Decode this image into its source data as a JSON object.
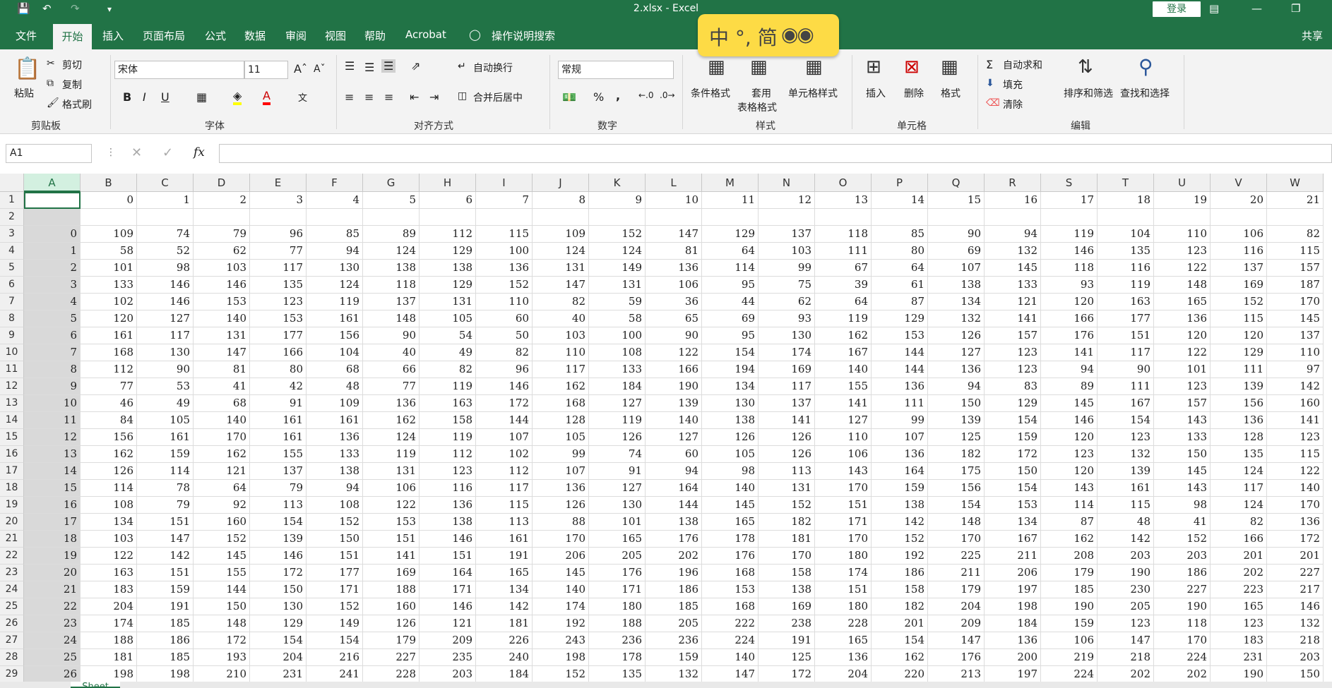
{
  "title": "2.xlsx  -  Excel",
  "login": "登录",
  "menu": [
    "文件",
    "开始",
    "插入",
    "页面布局",
    "公式",
    "数据",
    "审阅",
    "视图",
    "帮助",
    "Acrobat",
    "操作说明搜索"
  ],
  "share": "共享",
  "ime": {
    "text": "中 °, 简"
  },
  "clipboard": {
    "paste": "粘贴",
    "cut": "剪切",
    "copy": "复制",
    "format_painter": "格式刷",
    "group": "剪贴板"
  },
  "font": {
    "name": "宋体",
    "size": "11",
    "bold": "B",
    "italic": "I",
    "underline": "U",
    "group": "字体"
  },
  "align": {
    "wrap": "自动换行",
    "merge": "合并后居中",
    "group": "对齐方式"
  },
  "number": {
    "format": "常规",
    "percent": "%",
    "comma": ",",
    "group": "数字"
  },
  "styles": {
    "cond": "条件格式",
    "table_line1": "套用",
    "table_line2": "表格格式",
    "cell": "单元格样式",
    "group": "样式"
  },
  "cells": {
    "insert": "插入",
    "delete": "删除",
    "format": "格式",
    "group": "单元格"
  },
  "editing": {
    "autosum": "自动求和",
    "fill": "填充",
    "clear": "清除",
    "sort": "排序和筛选",
    "find": "查找和选择",
    "group": "编辑"
  },
  "namebox": "A1",
  "fx": "fx",
  "columns": [
    "A",
    "B",
    "C",
    "D",
    "E",
    "F",
    "G",
    "H",
    "I",
    "J",
    "K",
    "L",
    "M",
    "N",
    "O",
    "P",
    "Q",
    "R",
    "S",
    "T",
    "U",
    "V",
    "W"
  ],
  "header_row": [
    "",
    "0",
    "1",
    "2",
    "3",
    "4",
    "5",
    "6",
    "7",
    "8",
    "9",
    "10",
    "11",
    "12",
    "13",
    "14",
    "15",
    "16",
    "17",
    "18",
    "19",
    "20",
    "21"
  ],
  "data_rows": [
    [
      0,
      109,
      74,
      79,
      96,
      85,
      89,
      112,
      115,
      109,
      152,
      147,
      129,
      137,
      118,
      85,
      90,
      94,
      119,
      104,
      110,
      106,
      82
    ],
    [
      1,
      58,
      52,
      62,
      77,
      94,
      124,
      129,
      100,
      124,
      124,
      81,
      64,
      103,
      111,
      80,
      69,
      132,
      146,
      135,
      123,
      116,
      115
    ],
    [
      2,
      101,
      98,
      103,
      117,
      130,
      138,
      138,
      136,
      131,
      149,
      136,
      114,
      99,
      67,
      64,
      107,
      145,
      118,
      116,
      122,
      137,
      157
    ],
    [
      3,
      133,
      146,
      146,
      135,
      124,
      118,
      129,
      152,
      147,
      131,
      106,
      95,
      75,
      39,
      61,
      138,
      133,
      93,
      119,
      148,
      169,
      187
    ],
    [
      4,
      102,
      146,
      153,
      123,
      119,
      137,
      131,
      110,
      82,
      59,
      36,
      44,
      62,
      64,
      87,
      134,
      121,
      120,
      163,
      165,
      152,
      170
    ],
    [
      5,
      120,
      127,
      140,
      153,
      161,
      148,
      105,
      60,
      40,
      58,
      65,
      69,
      93,
      119,
      129,
      132,
      141,
      166,
      177,
      136,
      115,
      145
    ],
    [
      6,
      161,
      117,
      131,
      177,
      156,
      90,
      54,
      50,
      103,
      100,
      90,
      95,
      130,
      162,
      153,
      126,
      157,
      176,
      151,
      120,
      120,
      137
    ],
    [
      7,
      168,
      130,
      147,
      166,
      104,
      40,
      49,
      82,
      110,
      108,
      122,
      154,
      174,
      167,
      144,
      127,
      123,
      141,
      117,
      122,
      129,
      110
    ],
    [
      8,
      112,
      90,
      81,
      80,
      68,
      66,
      82,
      96,
      117,
      133,
      166,
      194,
      169,
      140,
      144,
      136,
      123,
      94,
      90,
      101,
      111,
      97
    ],
    [
      9,
      77,
      53,
      41,
      42,
      48,
      77,
      119,
      146,
      162,
      184,
      190,
      134,
      117,
      155,
      136,
      94,
      83,
      89,
      111,
      123,
      139,
      142
    ],
    [
      10,
      46,
      49,
      68,
      91,
      109,
      136,
      163,
      172,
      168,
      127,
      139,
      130,
      137,
      141,
      111,
      150,
      129,
      145,
      167,
      157,
      156,
      160
    ],
    [
      11,
      84,
      105,
      140,
      161,
      161,
      162,
      158,
      144,
      128,
      119,
      140,
      138,
      141,
      127,
      99,
      139,
      154,
      146,
      154,
      143,
      136,
      141
    ],
    [
      12,
      156,
      161,
      170,
      161,
      136,
      124,
      119,
      107,
      105,
      126,
      127,
      126,
      126,
      110,
      107,
      125,
      159,
      120,
      123,
      133,
      128,
      123
    ],
    [
      13,
      162,
      159,
      162,
      155,
      133,
      119,
      112,
      102,
      99,
      74,
      60,
      105,
      126,
      106,
      136,
      182,
      172,
      123,
      132,
      150,
      135,
      115
    ],
    [
      14,
      126,
      114,
      121,
      137,
      138,
      131,
      123,
      112,
      107,
      91,
      94,
      98,
      113,
      143,
      164,
      175,
      150,
      120,
      139,
      145,
      124,
      122
    ],
    [
      15,
      114,
      78,
      64,
      79,
      94,
      106,
      116,
      117,
      136,
      127,
      164,
      140,
      131,
      170,
      159,
      156,
      154,
      143,
      161,
      143,
      117,
      140
    ],
    [
      16,
      108,
      79,
      92,
      113,
      108,
      122,
      136,
      115,
      126,
      130,
      144,
      145,
      152,
      151,
      138,
      154,
      153,
      114,
      115,
      98,
      124,
      170
    ],
    [
      17,
      134,
      151,
      160,
      154,
      152,
      153,
      138,
      113,
      88,
      101,
      138,
      165,
      182,
      171,
      142,
      148,
      134,
      87,
      48,
      41,
      82,
      136
    ],
    [
      18,
      103,
      147,
      152,
      139,
      150,
      151,
      146,
      161,
      170,
      165,
      176,
      178,
      181,
      170,
      152,
      170,
      167,
      162,
      142,
      152,
      166,
      172
    ],
    [
      19,
      122,
      142,
      145,
      146,
      151,
      141,
      151,
      191,
      206,
      205,
      202,
      176,
      170,
      180,
      192,
      225,
      211,
      208,
      203,
      203,
      201,
      201
    ],
    [
      20,
      163,
      151,
      155,
      172,
      177,
      169,
      164,
      165,
      145,
      176,
      196,
      168,
      158,
      174,
      186,
      211,
      206,
      179,
      190,
      186,
      202,
      227
    ],
    [
      21,
      183,
      159,
      144,
      150,
      171,
      188,
      171,
      134,
      140,
      171,
      186,
      153,
      138,
      151,
      158,
      179,
      197,
      185,
      230,
      227,
      223,
      217
    ],
    [
      22,
      204,
      191,
      150,
      130,
      152,
      160,
      146,
      142,
      174,
      180,
      185,
      168,
      169,
      180,
      182,
      204,
      198,
      190,
      205,
      190,
      165,
      146
    ],
    [
      23,
      174,
      185,
      148,
      129,
      149,
      126,
      121,
      181,
      192,
      188,
      205,
      222,
      238,
      228,
      201,
      209,
      184,
      159,
      123,
      118,
      123,
      132
    ],
    [
      24,
      188,
      186,
      172,
      154,
      154,
      179,
      209,
      226,
      243,
      236,
      236,
      224,
      191,
      165,
      154,
      147,
      136,
      106,
      147,
      170,
      183,
      218
    ],
    [
      25,
      181,
      185,
      193,
      204,
      216,
      227,
      235,
      240,
      198,
      178,
      159,
      140,
      125,
      136,
      162,
      176,
      200,
      219,
      218,
      224,
      231,
      203
    ],
    [
      26,
      198,
      198,
      210,
      231,
      241,
      228,
      203,
      184,
      152,
      135,
      132,
      147,
      172,
      204,
      220,
      213,
      197,
      224,
      202,
      202,
      190,
      150
    ]
  ],
  "sheet_tab": "Sheet"
}
